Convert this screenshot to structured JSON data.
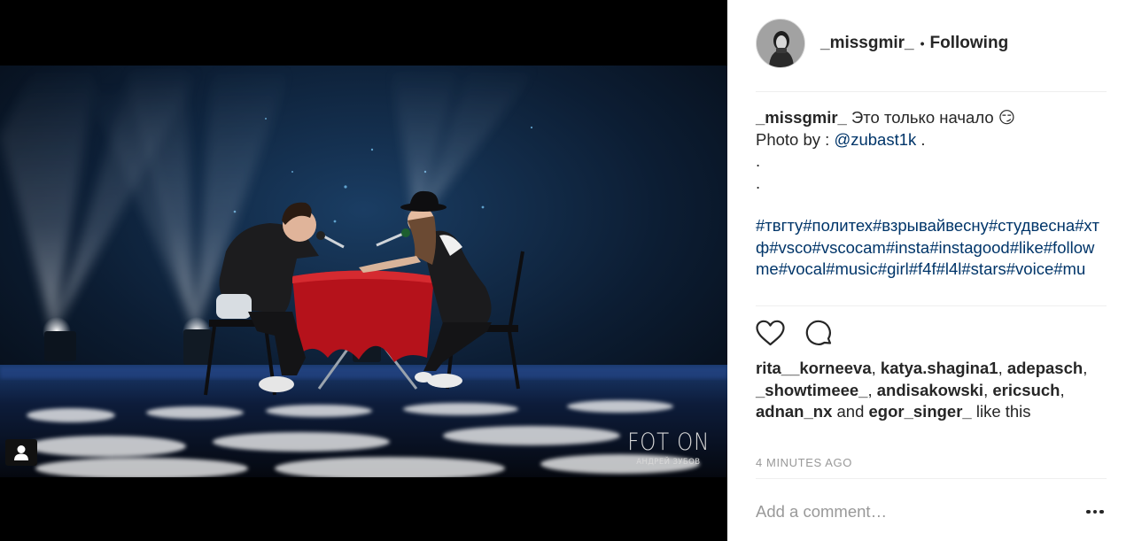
{
  "post": {
    "username": "_missgmir_",
    "follow_status": "Following",
    "separator": "•",
    "caption": {
      "text": "Это только начало",
      "emoji": "😏",
      "photo_by_prefix": "Photo by :",
      "photo_by_handle": "@zubast1k",
      "photo_by_suffix": ".",
      "dot_line_1": ".",
      "dot_line_2": ".",
      "hashtags": "#твгту#политех#взрывайвесну#студвесна#хтф#vsco#vscocam#insta#instagood#like#followme#vocal#music#girl#f4f#l4l#stars#voice#mu"
    },
    "likes": {
      "users": [
        "rita__korneeva",
        "katya.shagina1",
        "adepasch",
        "_showtimeee_",
        "andisakowski",
        "ericsuch",
        "adnan_nx",
        "egor_singer_"
      ],
      "sep_comma": ",",
      "and_word": "and",
      "suffix": "like this"
    },
    "timestamp": "4 MINUTES AGO",
    "comment_placeholder": "Add a comment…"
  },
  "photo": {
    "watermark_logo": "FOT ON",
    "watermark_sub": "АНДРЕЙ ЗУБОВ"
  },
  "icons": {
    "like": "heart-icon",
    "comment": "comment-icon",
    "more": "more-options-icon",
    "tag": "user-tag-icon"
  },
  "colors": {
    "link": "#003569",
    "text": "#262626",
    "muted": "#999999",
    "stage_cloth": "#b5121b"
  }
}
